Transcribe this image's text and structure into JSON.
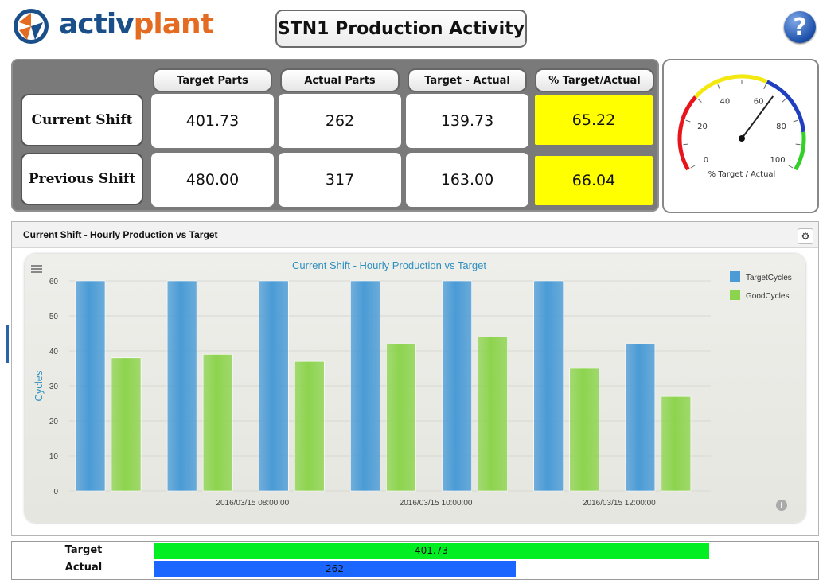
{
  "header": {
    "logo_part1": "activ",
    "logo_part2": "plant",
    "title": "STN1 Production Activity",
    "help_label": "?"
  },
  "kpi": {
    "columns": [
      "Target Parts",
      "Actual Parts",
      "Target - Actual",
      "% Target/Actual"
    ],
    "rows": [
      {
        "label": "Current Shift",
        "values": [
          "401.73",
          "262",
          "139.73",
          "65.22"
        ]
      },
      {
        "label": "Previous Shift",
        "values": [
          "480.00",
          "317",
          "163.00",
          "66.04"
        ]
      }
    ],
    "highlight_color": "#ffff00"
  },
  "gauge": {
    "caption": "% Target / Actual",
    "ticks": [
      "0",
      "20",
      "40",
      "60",
      "80",
      "100"
    ],
    "value": 65.22,
    "bands": [
      {
        "from": 0,
        "to": 30,
        "color": "#e8141c"
      },
      {
        "from": 30,
        "to": 60,
        "color": "#f3e80f"
      },
      {
        "from": 60,
        "to": 85,
        "color": "#1f3fbf"
      },
      {
        "from": 85,
        "to": 100,
        "color": "#33d02a"
      }
    ]
  },
  "chart_panel": {
    "header_title": "Current Shift - Hourly Production vs Target",
    "settings_icon": "gear-icon",
    "menu_icon": "hamburger-menu-icon",
    "info_icon": "info-icon"
  },
  "chart_data": {
    "type": "bar",
    "title": "Current Shift - Hourly Production vs Target",
    "ylabel": "Cycles",
    "xlabel": "",
    "ylim": [
      0,
      60
    ],
    "yticks": [
      0,
      10,
      20,
      30,
      40,
      50,
      60
    ],
    "categories": [
      "",
      "2016/03/15 08:00:00",
      "",
      "2016/03/15 10:00:00",
      "",
      "2016/03/15 12:00:00",
      ""
    ],
    "series": [
      {
        "name": "TargetCycles",
        "color": "#4a9bd6",
        "values": [
          60,
          60,
          60,
          60,
          60,
          60,
          42
        ]
      },
      {
        "name": "GoodCycles",
        "color": "#8dd44e",
        "values": [
          38,
          39,
          37,
          42,
          44,
          35,
          27
        ]
      }
    ],
    "legend_position": "right",
    "grid": true
  },
  "bottom": {
    "rows": [
      {
        "label": "Target",
        "value": "401.73",
        "fraction": 1.0,
        "color": "#00ee22"
      },
      {
        "label": "Actual",
        "value": "262",
        "fraction": 0.652,
        "color": "#1a66ff"
      }
    ]
  }
}
